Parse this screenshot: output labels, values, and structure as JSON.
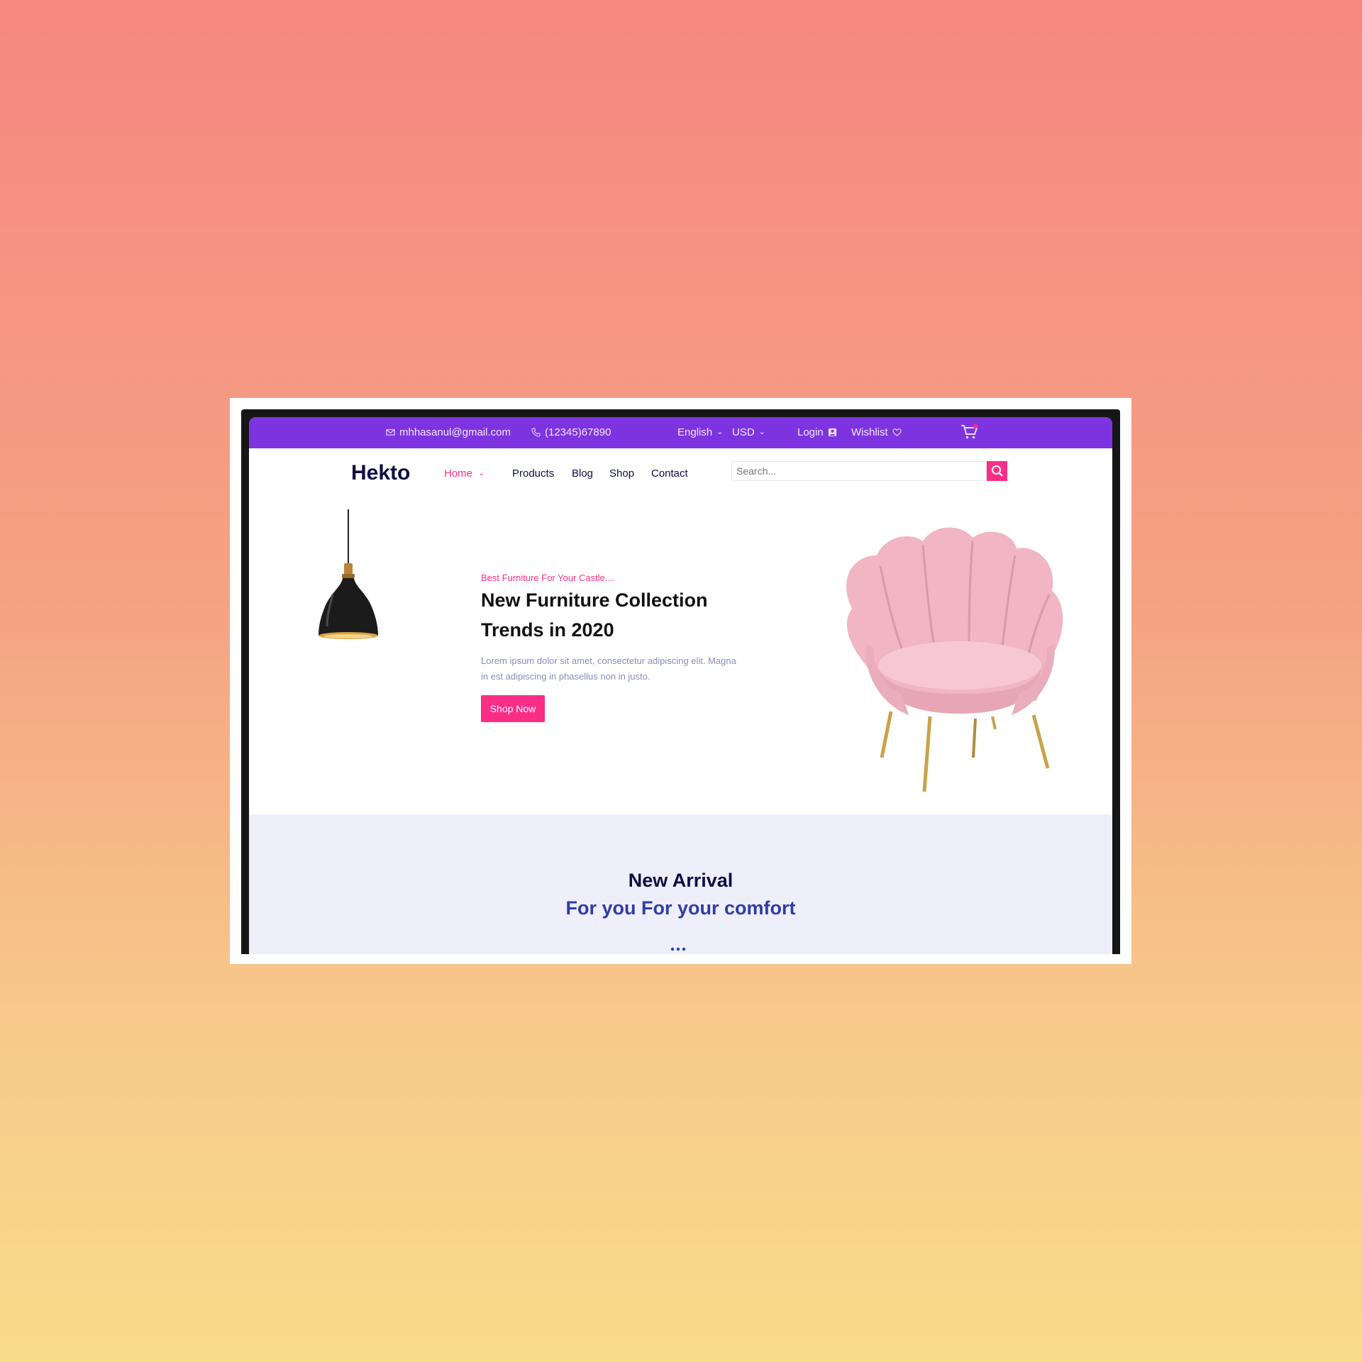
{
  "topbar": {
    "email": "mhhasanul@gmail.com",
    "phone": "(12345)67890",
    "language": "English",
    "currency": "USD",
    "login": "Login",
    "wishlist": "Wishlist",
    "icons": [
      "mail-icon",
      "phone-icon",
      "chevron-down-icon",
      "user-icon",
      "heart-icon",
      "cart-icon"
    ]
  },
  "nav": {
    "logo": "Hekto",
    "items": [
      "Home",
      "Products",
      "Blog",
      "Shop",
      "Contact"
    ],
    "search_placeholder": "Search..."
  },
  "hero": {
    "tagline": "Best Furniture For Your Castle....",
    "title_line1": "New Furniture Collection",
    "title_line2": "Trends in 2020",
    "desc_line1": "Lorem ipsum dolor sit amet, consectetur adipiscing elit. Magna",
    "desc_line2": "in est adipiscing in phasellus non in justo.",
    "cta": "Shop Now"
  },
  "arrivals": {
    "title": "New Arrival",
    "subtitle": "For you For your comfort"
  },
  "colors": {
    "topbar": "#7e33e0",
    "accent_pink": "#fb2e86",
    "navy": "#0d0e43",
    "subtitle_blue": "#2f3ca8",
    "section_bg": "#eeeffb",
    "chair_pink": "#f2b8c6",
    "chair_legs": "#c9a24a"
  }
}
